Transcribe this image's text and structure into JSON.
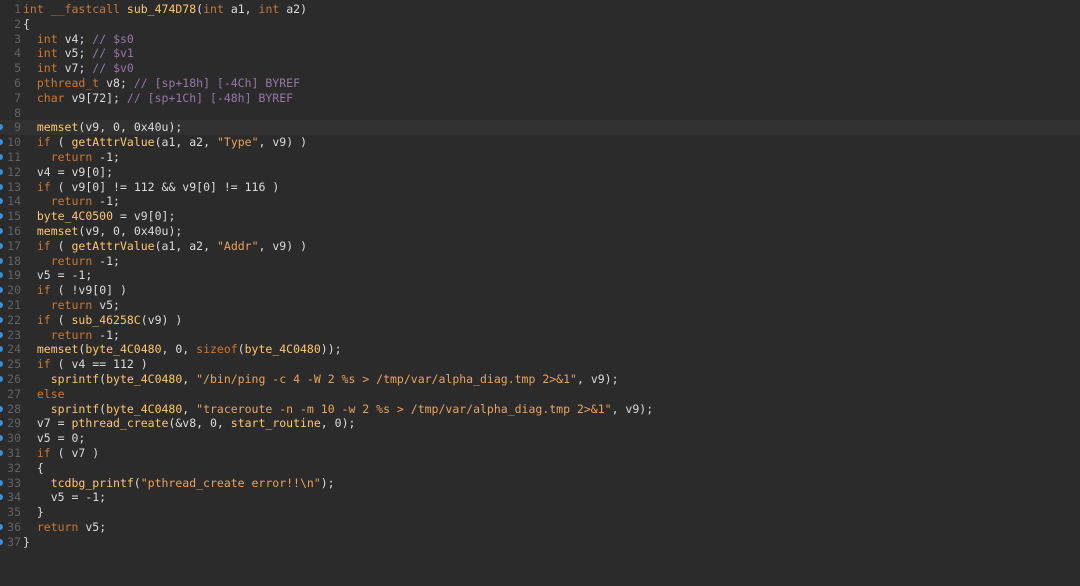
{
  "editor": {
    "lines": [
      {
        "n": "1",
        "dot": false,
        "hl": false,
        "code": "int __fastcall sub_474D78(int a1, int a2)"
      },
      {
        "n": "2",
        "dot": false,
        "hl": false,
        "code": "{"
      },
      {
        "n": "3",
        "dot": false,
        "hl": false,
        "code": "  int v4; // $s0"
      },
      {
        "n": "4",
        "dot": false,
        "hl": false,
        "code": "  int v5; // $v1"
      },
      {
        "n": "5",
        "dot": false,
        "hl": false,
        "code": "  int v7; // $v0"
      },
      {
        "n": "6",
        "dot": false,
        "hl": false,
        "code": "  pthread_t v8; // [sp+18h] [-4Ch] BYREF"
      },
      {
        "n": "7",
        "dot": false,
        "hl": false,
        "code": "  char v9[72]; // [sp+1Ch] [-48h] BYREF"
      },
      {
        "n": "8",
        "dot": false,
        "hl": false,
        "code": ""
      },
      {
        "n": "9",
        "dot": true,
        "hl": true,
        "code": "  memset(v9, 0, 0x40u);"
      },
      {
        "n": "10",
        "dot": true,
        "hl": false,
        "code": "  if ( getAttrValue(a1, a2, \"Type\", v9) )"
      },
      {
        "n": "11",
        "dot": true,
        "hl": false,
        "code": "    return -1;"
      },
      {
        "n": "12",
        "dot": true,
        "hl": false,
        "code": "  v4 = v9[0];"
      },
      {
        "n": "13",
        "dot": true,
        "hl": false,
        "code": "  if ( v9[0] != 112 && v9[0] != 116 )"
      },
      {
        "n": "14",
        "dot": true,
        "hl": false,
        "code": "    return -1;"
      },
      {
        "n": "15",
        "dot": true,
        "hl": false,
        "code": "  byte_4C0500 = v9[0];"
      },
      {
        "n": "16",
        "dot": true,
        "hl": false,
        "code": "  memset(v9, 0, 0x40u);"
      },
      {
        "n": "17",
        "dot": true,
        "hl": false,
        "code": "  if ( getAttrValue(a1, a2, \"Addr\", v9) )"
      },
      {
        "n": "18",
        "dot": true,
        "hl": false,
        "code": "    return -1;"
      },
      {
        "n": "19",
        "dot": true,
        "hl": false,
        "code": "  v5 = -1;"
      },
      {
        "n": "20",
        "dot": true,
        "hl": false,
        "code": "  if ( !v9[0] )"
      },
      {
        "n": "21",
        "dot": true,
        "hl": false,
        "code": "    return v5;"
      },
      {
        "n": "22",
        "dot": true,
        "hl": false,
        "code": "  if ( sub_46258C(v9) )"
      },
      {
        "n": "23",
        "dot": true,
        "hl": false,
        "code": "    return -1;"
      },
      {
        "n": "24",
        "dot": true,
        "hl": false,
        "code": "  memset(byte_4C0480, 0, sizeof(byte_4C0480));"
      },
      {
        "n": "25",
        "dot": true,
        "hl": false,
        "code": "  if ( v4 == 112 )"
      },
      {
        "n": "26",
        "dot": true,
        "hl": false,
        "code": "    sprintf(byte_4C0480, \"/bin/ping -c 4 -W 2 %s > /tmp/var/alpha_diag.tmp 2>&1\", v9);"
      },
      {
        "n": "27",
        "dot": false,
        "hl": false,
        "code": "  else"
      },
      {
        "n": "28",
        "dot": true,
        "hl": false,
        "code": "    sprintf(byte_4C0480, \"traceroute -n -m 10 -w 2 %s > /tmp/var/alpha_diag.tmp 2>&1\", v9);"
      },
      {
        "n": "29",
        "dot": true,
        "hl": false,
        "code": "  v7 = pthread_create(&v8, 0, start_routine, 0);"
      },
      {
        "n": "30",
        "dot": true,
        "hl": false,
        "code": "  v5 = 0;"
      },
      {
        "n": "31",
        "dot": true,
        "hl": false,
        "code": "  if ( v7 )"
      },
      {
        "n": "32",
        "dot": false,
        "hl": false,
        "code": "  {"
      },
      {
        "n": "33",
        "dot": true,
        "hl": false,
        "code": "    tcdbg_printf(\"pthread_create error!!\\n\");"
      },
      {
        "n": "34",
        "dot": true,
        "hl": false,
        "code": "    v5 = -1;"
      },
      {
        "n": "35",
        "dot": false,
        "hl": false,
        "code": "  }"
      },
      {
        "n": "36",
        "dot": true,
        "hl": false,
        "code": "  return v5;"
      },
      {
        "n": "37",
        "dot": true,
        "hl": false,
        "code": "}"
      }
    ]
  },
  "colors": {
    "background": "#2b2b2b",
    "breakpoint_dot": "#3d8fd6",
    "keyword": "#cc7832",
    "function": "#ffc66d",
    "string": "#e9a35d",
    "comment": "#9876aa"
  }
}
